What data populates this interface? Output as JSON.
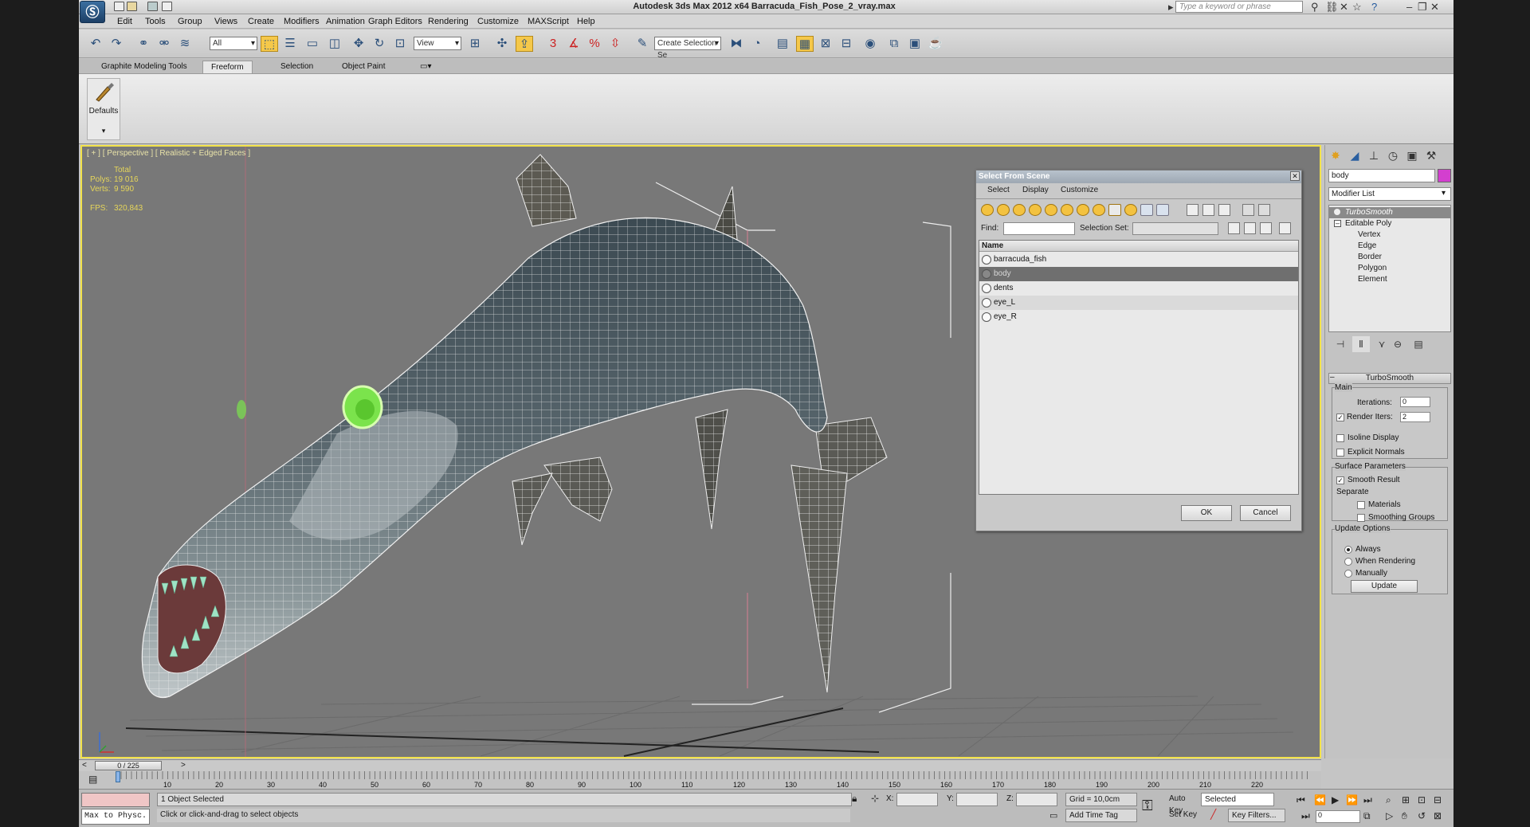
{
  "window": {
    "title": "Autodesk 3ds Max  2012 x64      Barracuda_Fish_Pose_2_vray.max",
    "search_placeholder": "Type a keyword or phrase"
  },
  "menu": [
    "Edit",
    "Tools",
    "Group",
    "Views",
    "Create",
    "Modifiers",
    "Animation",
    "Graph Editors",
    "Rendering",
    "Customize",
    "MAXScript",
    "Help"
  ],
  "toolbar": {
    "selection_filter": "All",
    "ref_coord": "View",
    "named_selection": "Create Selection Se"
  },
  "ribbon": {
    "tabs": [
      "Graphite Modeling Tools",
      "Freeform",
      "Selection",
      "Object Paint"
    ],
    "active_tab": "Freeform",
    "defaults_label": "Defaults"
  },
  "viewport": {
    "label": "[ + ] [ Perspective ] [ Realistic + Edged Faces ]",
    "stats": {
      "total_label": "Total",
      "polys_label": "Polys:",
      "polys": "19 016",
      "verts_label": "Verts:",
      "verts": "9 590",
      "fps_label": "FPS:",
      "fps": "320,843"
    }
  },
  "dialog": {
    "title": "Select From Scene",
    "menus": [
      "Select",
      "Display",
      "Customize"
    ],
    "find_label": "Find:",
    "selection_set_label": "Selection Set:",
    "column": "Name",
    "items": [
      "barracuda_fish",
      "body",
      "dents",
      "eye_L",
      "eye_R"
    ],
    "selected_item": "body",
    "ok": "OK",
    "cancel": "Cancel"
  },
  "command_panel": {
    "object_name": "body",
    "object_color": "#d33fcf",
    "modifier_list": "Modifier List",
    "stack": {
      "top": "TurboSmooth",
      "base": "Editable Poly",
      "subs": [
        "Vertex",
        "Edge",
        "Border",
        "Polygon",
        "Element"
      ]
    },
    "turbosmooth": {
      "title": "TurboSmooth",
      "main": "Main",
      "iterations_label": "Iterations:",
      "iterations": "0",
      "render_iters_label": "Render Iters:",
      "render_iters": "2",
      "isoline": "Isoline Display",
      "explicit": "Explicit Normals",
      "surface": "Surface Parameters",
      "smooth_result": "Smooth Result",
      "separate": "Separate",
      "materials": "Materials",
      "smoothing": "Smoothing Groups",
      "update_options": "Update Options",
      "always": "Always",
      "when_rendering": "When Rendering",
      "manually": "Manually",
      "update_btn": "Update"
    }
  },
  "timeline": {
    "position": "0 / 225",
    "ticks": [
      "10",
      "20",
      "30",
      "40",
      "50",
      "60",
      "70",
      "80",
      "90",
      "100",
      "110",
      "120",
      "130",
      "140",
      "150",
      "160",
      "170",
      "180",
      "190",
      "200",
      "210",
      "220"
    ]
  },
  "status": {
    "maxscript": "Max to Physc.",
    "selected": "1 Object Selected",
    "prompt": "Click or click-and-drag to select objects",
    "x_label": "X:",
    "y_label": "Y:",
    "z_label": "Z:",
    "grid": "Grid = 10,0cm",
    "add_time_tag": "Add Time Tag",
    "auto_key": "Auto Key",
    "key_mode": "Selected",
    "set_key": "Set Key",
    "key_filters": "Key Filters...",
    "frame": "0"
  }
}
